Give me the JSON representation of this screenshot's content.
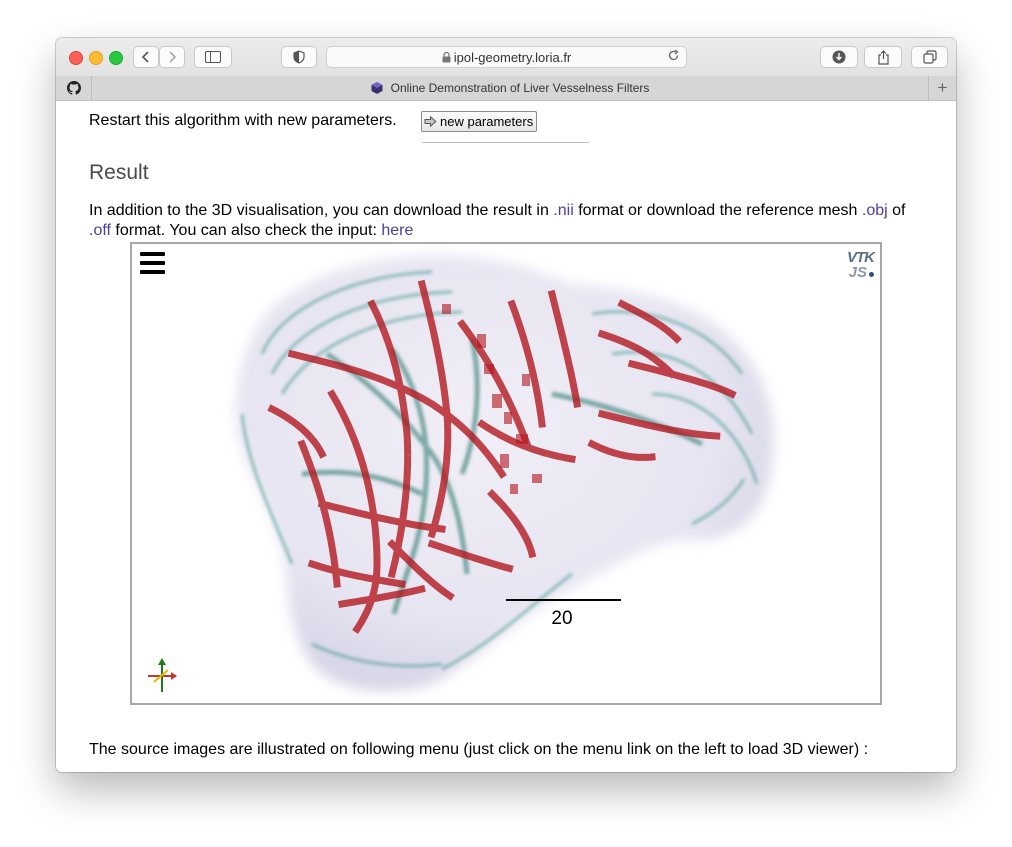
{
  "browser": {
    "url": "ipol-geometry.loria.fr",
    "tab_title": "Online Demonstration of Liver Vesselness Filters",
    "new_tab": "+"
  },
  "page": {
    "restart_text": "Restart this algorithm with new parameters.",
    "new_params_label": "new parameters",
    "result_heading": "Result",
    "desc_part1": "In addition to the 3D visualisation, you can download the result in ",
    "nii_link": ".nii",
    "desc_part2": " format or download the reference mesh ",
    "obj_link": ".obj",
    "desc_part3": " of ",
    "off_link": ".off",
    "desc_part4": " format. You can also check the input: ",
    "here_link": "here",
    "footer_text": "The source images are illustrated on following menu (just click on the menu link on the left to load 3D viewer) :"
  },
  "viewer": {
    "scale_label": "20",
    "logo_top": "VTK",
    "logo_bottom": "JS",
    "vessel_color": "#b3141c",
    "tissue_color": "#3a8f88"
  },
  "colors": {
    "link": "#4b3fa0",
    "traffic_red": "#fe5f57",
    "traffic_yellow": "#febc2e",
    "traffic_green": "#28c840"
  }
}
